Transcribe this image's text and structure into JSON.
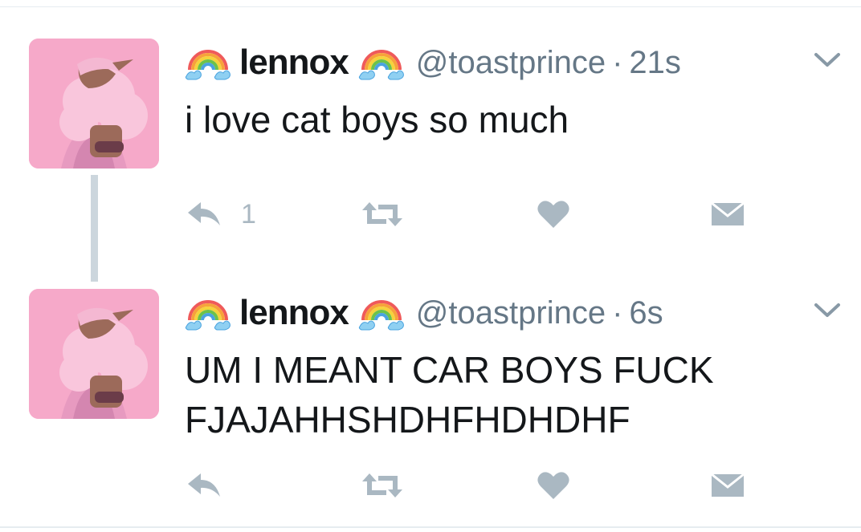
{
  "tweets": [
    {
      "name": "lennox",
      "handle": "@toastprince",
      "separator": "·",
      "time": "21s",
      "text": "i love cat boys so much",
      "reply_count": "1"
    },
    {
      "name": "lennox",
      "handle": "@toastprince",
      "separator": "·",
      "time": "6s",
      "text": "UM I MEANT CAR BOYS FUCK FJAJAHHSHDHFHDHDHF",
      "reply_count": ""
    }
  ],
  "icons": {
    "name_emoji": "rainbow-icon",
    "reply": "reply-icon",
    "retweet": "retweet-icon",
    "like": "heart-icon",
    "dm": "envelope-icon",
    "menu": "chevron-down-icon"
  },
  "colors": {
    "text": "#14171a",
    "secondary": "#657786",
    "action": "#aab8c2",
    "thread_line": "#ccd6dd",
    "avatar_bg": "#f6a9c9"
  }
}
